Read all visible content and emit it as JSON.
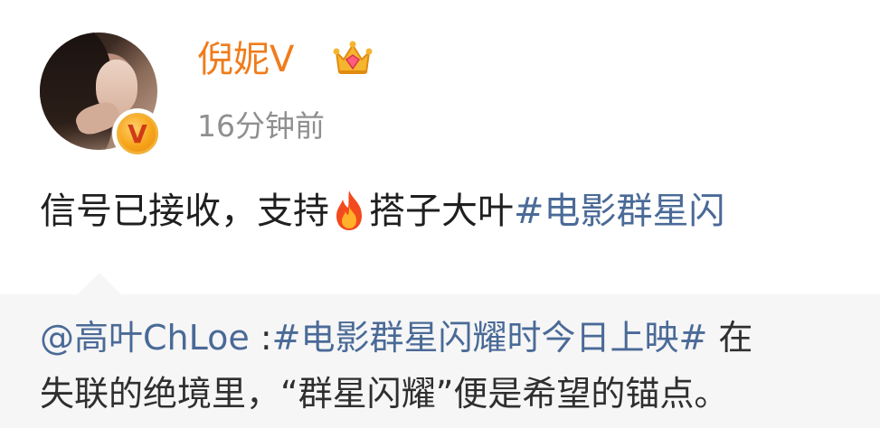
{
  "post": {
    "username": "倪妮V",
    "timestamp": "16分钟前",
    "text": {
      "plain_before": "信号已接收，支持",
      "plain_after": "搭子大叶",
      "hashtag": "#电影群星闪"
    }
  },
  "repost": {
    "mention": "@高叶ChLoe",
    "separator": " :",
    "hashtag": "#电影群星闪耀时今日上映#",
    "after_hashtag": " 在",
    "line2": "失联的绝境里，“群星闪耀”便是希望的锚点。"
  },
  "icons": {
    "crown": "crown-icon",
    "fire": "fire-icon",
    "verified": "verified-badge-icon"
  },
  "colors": {
    "username": "#f07c1c",
    "hashtag": "#4a6a97",
    "timestamp": "#8f8f8f",
    "repost_bg": "#f6f6f6"
  }
}
